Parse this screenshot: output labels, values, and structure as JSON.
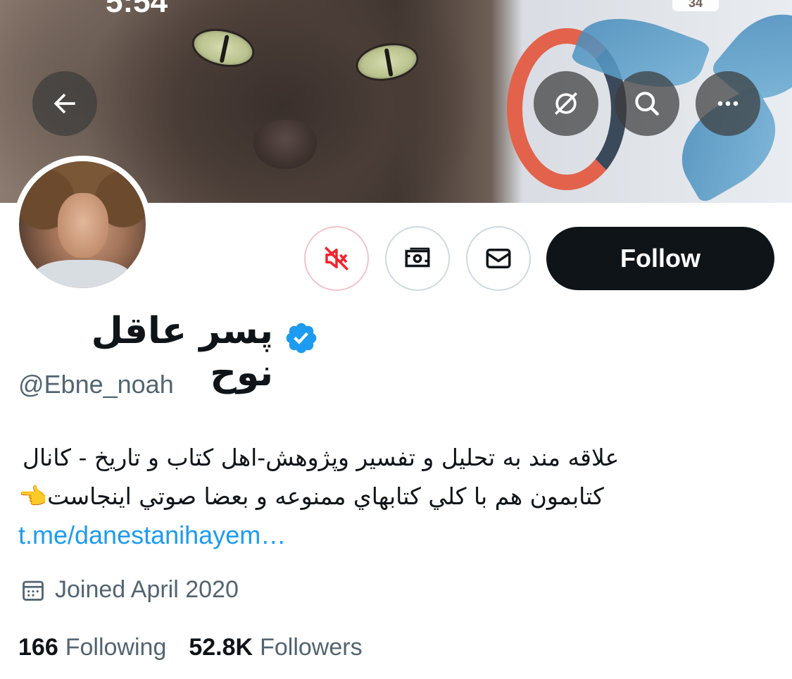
{
  "status_bar": {
    "time": "5:54",
    "battery": "34"
  },
  "profile": {
    "display_name": "پسر عاقل نوح",
    "handle": "@Ebne_noah",
    "bio_line_1": "علاقه مند به تحلیل و تفسیر وپژوهش-اهل کتاب و تاریخ - کانال",
    "bio_line_2": "کتابمون هم با کلي کتابهاي ممنوعه و بعضا صوتي اینجاست👈",
    "bio_link": "t.me/danestanihayem…",
    "joined": "Joined April 2020",
    "following_count": "166",
    "following_label": "Following",
    "followers_count": "52.8K",
    "followers_label": "Followers"
  },
  "actions": {
    "follow_label": "Follow"
  },
  "colors": {
    "accent_blue": "#1d9bf0",
    "follow_bg": "#0f1419",
    "secondary_text": "#536471",
    "mute_red": "#f4212e"
  },
  "icons": {
    "back": "arrow-left-icon",
    "hide_replies": "no-sync-icon",
    "search": "search-icon",
    "more": "more-dots-icon",
    "mute": "speaker-mute-icon",
    "tip": "money-tip-icon",
    "message": "envelope-icon",
    "verified": "verified-badge-icon",
    "calendar": "calendar-icon"
  }
}
